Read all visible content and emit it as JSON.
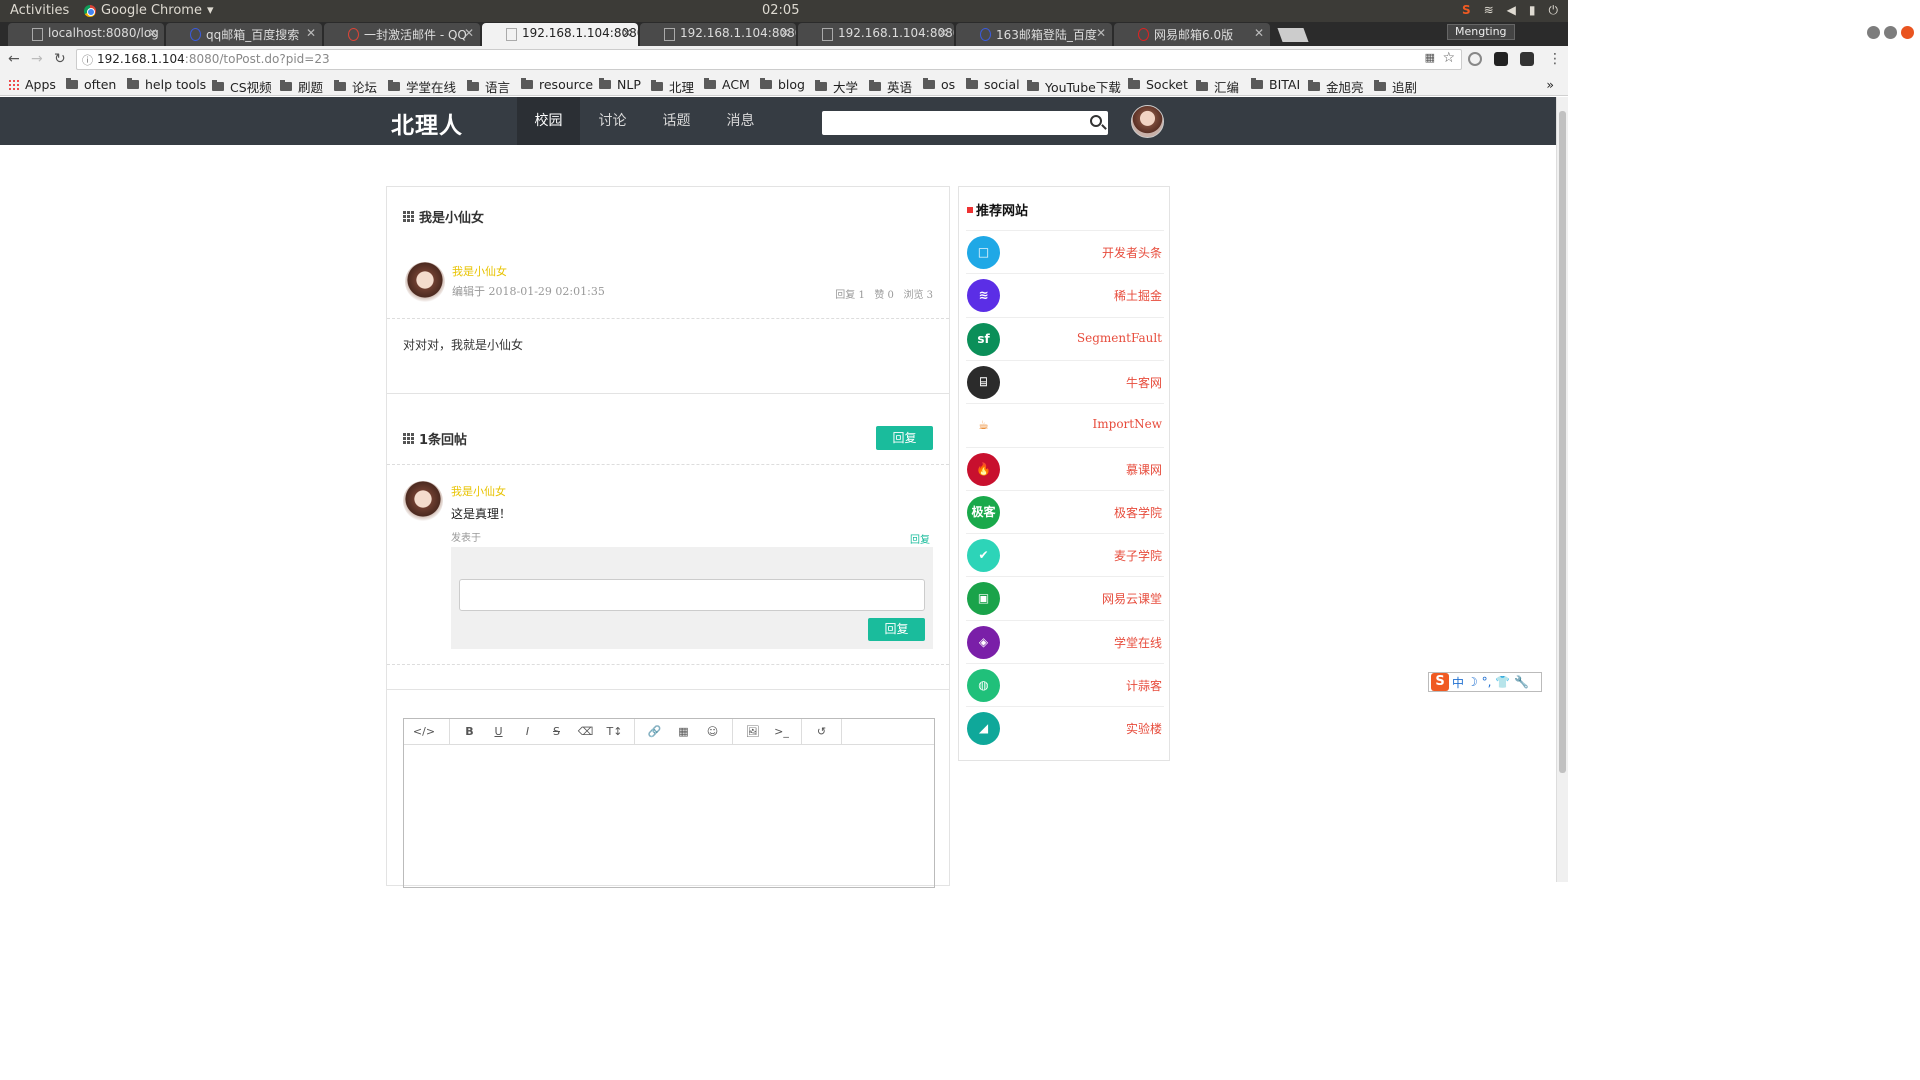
{
  "os": {
    "activities": "Activities",
    "app_name": "Google Chrome",
    "clock": "02:05"
  },
  "browser": {
    "tabs": [
      {
        "title": "localhost:8080/log"
      },
      {
        "title": "qq邮箱_百度搜索"
      },
      {
        "title": "一封激活邮件 - QQ"
      },
      {
        "title": "192.168.1.104:8080"
      },
      {
        "title": "192.168.1.104:8080"
      },
      {
        "title": "192.168.1.104:8080"
      },
      {
        "title": "163邮箱登陆_百度"
      },
      {
        "title": "网易邮箱6.0版"
      }
    ],
    "profile": "Mengting",
    "url_host": "192.168.1.104",
    "url_rest": ":8080/toPost.do?pid=23",
    "bookmarks": [
      "Apps",
      "often",
      "help tools",
      "CS视频",
      "刷题",
      "论坛",
      "学堂在线",
      "语言",
      "resource",
      "NLP",
      "北理",
      "ACM",
      "blog",
      "大学",
      "英语",
      "os",
      "social",
      "YouTube下载",
      "Socket",
      "汇编",
      "BITAI",
      "金旭亮",
      "追剧"
    ],
    "bookmarks_more": "»"
  },
  "site": {
    "logo": "北理人",
    "nav": [
      "校园",
      "讨论",
      "话题",
      "消息"
    ],
    "search_placeholder": ""
  },
  "post": {
    "title": "我是小仙女",
    "author": "我是小仙女",
    "edited": "编辑于 2018-01-29 02:01:35",
    "stats": "回复 1   赞 0   浏览 3",
    "content": "对对对，我就是小仙女"
  },
  "replies": {
    "header": "1条回帖",
    "reply_button": "回复",
    "items": [
      {
        "author": "我是小仙女",
        "content": "这是真理！",
        "posted": "发表于",
        "reply_link": "回复",
        "submit": "回复"
      }
    ]
  },
  "editor": {
    "tools": [
      "</>",
      "B",
      "U",
      "I",
      "S",
      "⌫",
      "T↕",
      "🔗",
      "▦",
      "☺",
      "🖼",
      ">_",
      "↺"
    ]
  },
  "sidebar": {
    "title": "推荐网站",
    "sites": [
      {
        "name": "开发者头条",
        "icon": "□",
        "color": "#1fa8e6"
      },
      {
        "name": "稀土掘金",
        "icon": "≋",
        "color": "#5b2ee6"
      },
      {
        "name": "SegmentFault",
        "icon": "sf",
        "color": "#0b8f59"
      },
      {
        "name": "牛客网",
        "icon": "⌸",
        "color": "#2b2b2b"
      },
      {
        "name": "ImportNew",
        "icon": "☕",
        "color": "#ffffff"
      },
      {
        "name": "慕课网",
        "icon": "🔥",
        "color": "#c8102e"
      },
      {
        "name": "极客学院",
        "icon": "极客",
        "color": "#19a94b"
      },
      {
        "name": "麦子学院",
        "icon": "✔",
        "color": "#2dd4b8"
      },
      {
        "name": "网易云课堂",
        "icon": "▣",
        "color": "#1aa34a"
      },
      {
        "name": "学堂在线",
        "icon": "◈",
        "color": "#7a1fa8"
      },
      {
        "name": "计蒜客",
        "icon": "◍",
        "color": "#20c07a"
      },
      {
        "name": "实验楼",
        "icon": "◢",
        "color": "#0fa89a"
      }
    ]
  },
  "ime": {
    "logo": "S",
    "lang": "中",
    "icons": "☽ °, 👕 🔧"
  }
}
